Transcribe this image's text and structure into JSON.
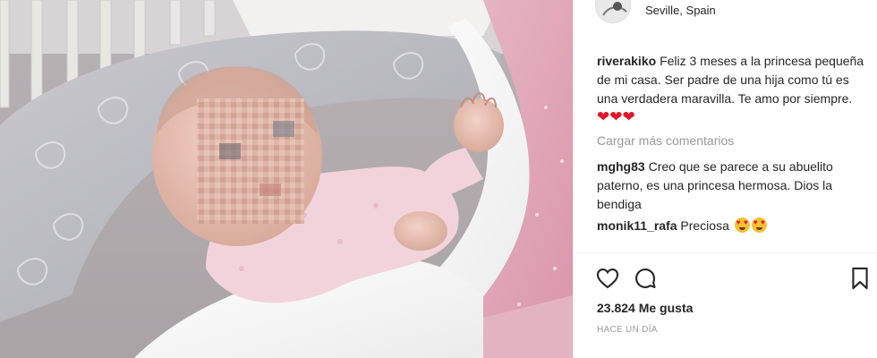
{
  "post": {
    "location": "Seville, Spain",
    "photo_alt": "baby photo"
  },
  "caption": {
    "user": "riverakiko",
    "text": "Feliz 3 meses a la princesa pequeña de mi casa. Ser padre de una hija como tú es una verdadera maravilla. Te amo por siempre.",
    "hearts": "❤❤❤"
  },
  "load_more": "Cargar más comentarios",
  "comments": [
    {
      "user": "mghg83",
      "text": "Creo que se parece a su abuelito paterno, es una princesa hermosa. Dios la bendiga"
    },
    {
      "user": "monik11_rafa",
      "text": "Preciosa"
    }
  ],
  "partial_comment": "····· ···· ·· ···· ·· ·· ·· · ·· ····· ·· ···",
  "actions": {
    "like_icon": "heart-outline-icon",
    "comment_icon": "comment-bubble-icon",
    "save_icon": "bookmark-icon"
  },
  "likes": "23.824 Me gusta",
  "timestamp": "HACE UN DÍA"
}
